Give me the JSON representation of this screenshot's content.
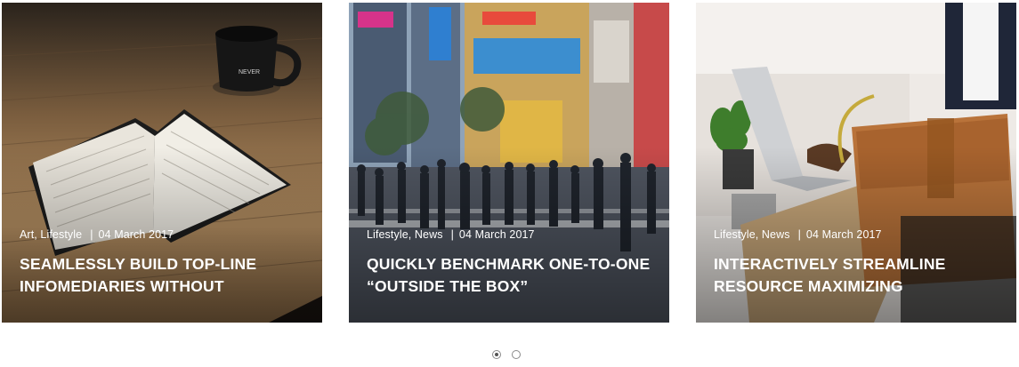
{
  "carousel": {
    "posts": [
      {
        "categories": "Art, Lifestyle",
        "separator": "|",
        "date": "04 March 2017",
        "title": "Seamlessly build top-line infomediaries without",
        "image": "book-and-mug-on-table-photo"
      },
      {
        "categories": "Lifestyle, News",
        "separator": "|",
        "date": "04 March 2017",
        "title": "Quickly benchmark one-to-one “outside the box”",
        "image": "city-crosswalk-crowd-photo"
      },
      {
        "categories": "Lifestyle, News",
        "separator": "|",
        "date": "04 March 2017",
        "title": "Interactively streamline resource maximizing",
        "image": "laptop-and-leather-bag-photo"
      }
    ],
    "pagination": {
      "pages": 2,
      "active_page": 1
    }
  }
}
